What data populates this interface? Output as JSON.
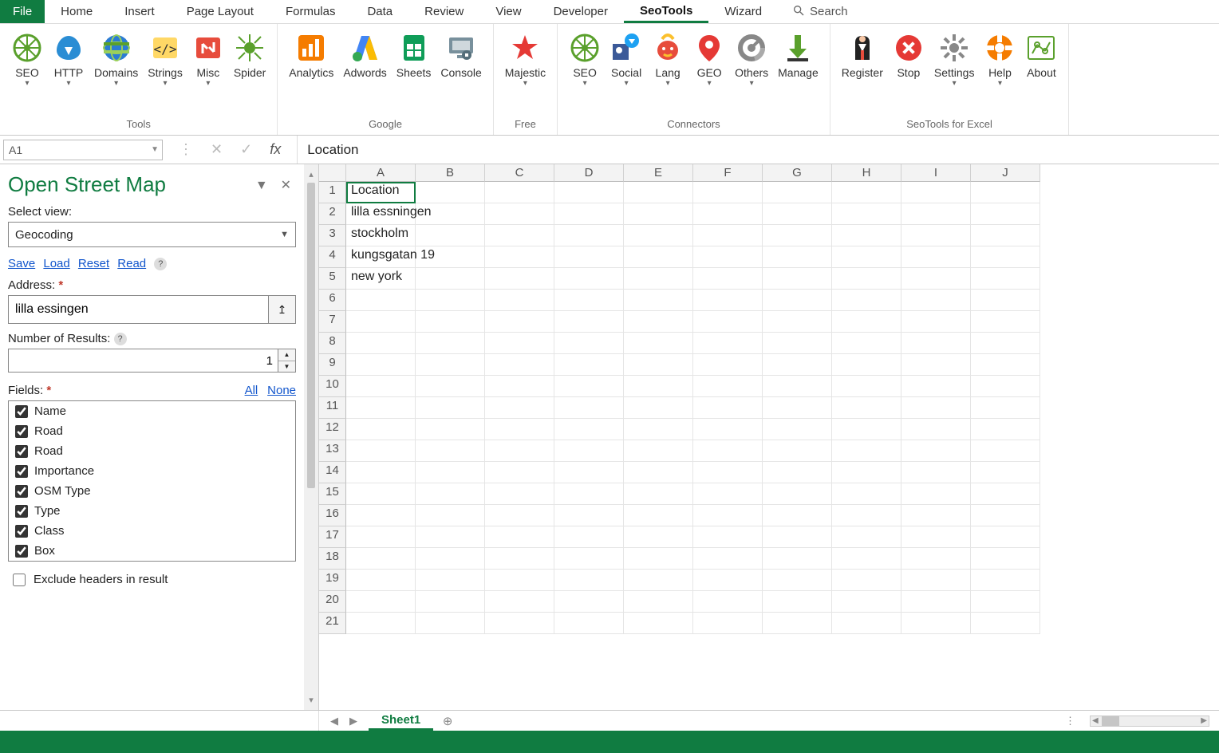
{
  "tabs": {
    "file": "File",
    "items": [
      "Home",
      "Insert",
      "Page Layout",
      "Formulas",
      "Data",
      "Review",
      "View",
      "Developer",
      "SeoTools",
      "Wizard"
    ],
    "active": "SeoTools",
    "search": "Search"
  },
  "ribbon": {
    "groups": [
      {
        "name": "Tools",
        "buttons": [
          {
            "label": "SEO",
            "icon": "seo",
            "caret": true
          },
          {
            "label": "HTTP",
            "icon": "http",
            "caret": true
          },
          {
            "label": "Domains",
            "icon": "domains",
            "caret": true
          },
          {
            "label": "Strings",
            "icon": "strings",
            "caret": true
          },
          {
            "label": "Misc",
            "icon": "misc",
            "caret": true
          },
          {
            "label": "Spider",
            "icon": "spider",
            "caret": false
          }
        ]
      },
      {
        "name": "Google",
        "buttons": [
          {
            "label": "Analytics",
            "icon": "analytics",
            "caret": false
          },
          {
            "label": "Adwords",
            "icon": "adwords",
            "caret": false
          },
          {
            "label": "Sheets",
            "icon": "sheets",
            "caret": false
          },
          {
            "label": "Console",
            "icon": "console",
            "caret": false
          }
        ]
      },
      {
        "name": "Free",
        "buttons": [
          {
            "label": "Majestic",
            "icon": "majestic",
            "caret": true
          }
        ]
      },
      {
        "name": "Connectors",
        "buttons": [
          {
            "label": "SEO",
            "icon": "seo",
            "caret": true
          },
          {
            "label": "Social",
            "icon": "social",
            "caret": true
          },
          {
            "label": "Lang",
            "icon": "lang",
            "caret": true
          },
          {
            "label": "GEO",
            "icon": "geo",
            "caret": true
          },
          {
            "label": "Others",
            "icon": "others",
            "caret": true
          },
          {
            "label": "Manage",
            "icon": "manage",
            "caret": false
          }
        ]
      },
      {
        "name": "SeoTools for Excel",
        "buttons": [
          {
            "label": "Register",
            "icon": "register",
            "caret": false
          },
          {
            "label": "Stop",
            "icon": "stop",
            "caret": false
          },
          {
            "label": "Settings",
            "icon": "settings",
            "caret": true
          },
          {
            "label": "Help",
            "icon": "help",
            "caret": true
          },
          {
            "label": "About",
            "icon": "about",
            "caret": false
          }
        ]
      }
    ]
  },
  "namebox": "A1",
  "formula": "Location",
  "taskpane": {
    "title": "Open Street Map",
    "select_label": "Select view:",
    "select_value": "Geocoding",
    "links": {
      "save": "Save",
      "load": "Load",
      "reset": "Reset",
      "read": "Read"
    },
    "address_label": "Address:",
    "address_value": "lilla essingen",
    "numres_label": "Number of Results:",
    "numres_value": "1",
    "fields_label": "Fields:",
    "fields_all": "All",
    "fields_none": "None",
    "fields": [
      "Name",
      "Road",
      "Road",
      "Importance",
      "OSM Type",
      "Type",
      "Class",
      "Box"
    ],
    "exclude_label": "Exclude headers in result"
  },
  "grid": {
    "columns": [
      "A",
      "B",
      "C",
      "D",
      "E",
      "F",
      "G",
      "H",
      "I",
      "J"
    ],
    "rows": 21,
    "cells": {
      "A1": "Location",
      "A2": "lilla essningen",
      "A3": "stockholm",
      "A4": "kungsgatan 19",
      "A5": "new york"
    },
    "selected": "A1"
  },
  "sheets": {
    "active": "Sheet1"
  }
}
